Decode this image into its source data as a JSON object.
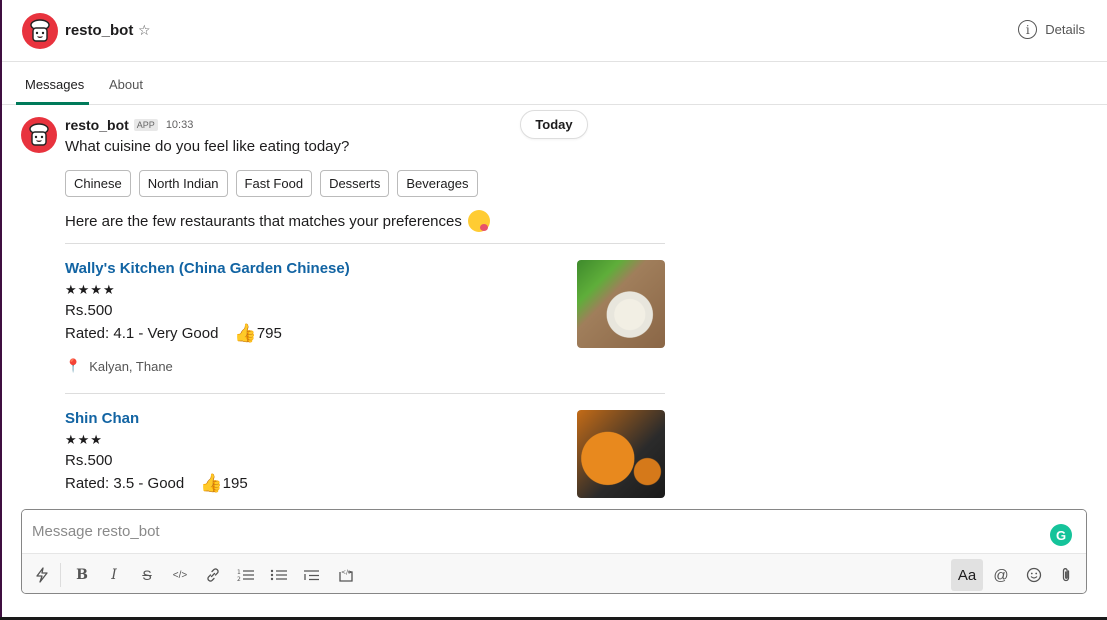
{
  "header": {
    "bot_name": "resto_bot",
    "star_icon": "star-outline-icon",
    "details_label": "Details",
    "info_icon": "info-icon"
  },
  "tabs": [
    {
      "label": "Messages",
      "active": true
    },
    {
      "label": "About",
      "active": false
    }
  ],
  "message": {
    "sender": "resto_bot",
    "badge": "APP",
    "time": "10:33",
    "date_divider": "Today",
    "question": "What cuisine do you feel like eating today?",
    "choices": [
      "Chinese",
      "North Indian",
      "Fast Food",
      "Desserts",
      "Beverages"
    ],
    "intro": "Here are the few restaurants that matches your preferences",
    "intro_emoji": "yum-face-emoji"
  },
  "restaurants": [
    {
      "name": "Wally's Kitchen (China Garden Chinese)",
      "stars": "★★★★",
      "star_count": 4,
      "price": "Rs.500",
      "rating": "Rated: 4.1 - Very Good",
      "votes": "795",
      "location": "Kalyan, Thane",
      "image": "fried-rice-with-vegetables-photo"
    },
    {
      "name": "Shin Chan",
      "stars": "★★★",
      "star_count": 3,
      "price": "Rs.500",
      "rating": "Rated: 3.5 - Good",
      "votes": "195",
      "image": "orange-noodles-photo"
    }
  ],
  "composer": {
    "placeholder": "Message resto_bot",
    "value": "",
    "toolbar": {
      "shortcuts": "lightning-icon",
      "bold": "B",
      "italic": "I",
      "strike": "S",
      "code": "</>",
      "link": "link-icon",
      "ordered_list": "ordered-list-icon",
      "bullet_list": "bullet-list-icon",
      "blockquote": "blockquote-icon",
      "code_block": "code-block-icon",
      "format_label": "Aa",
      "mention": "@",
      "emoji": "emoji-icon",
      "attach": "paperclip-icon"
    }
  },
  "colors": {
    "accent_tab": "#007a5a",
    "link": "#1264a3",
    "avatar_bg": "#e8333e",
    "grammarly": "#15c39a"
  }
}
